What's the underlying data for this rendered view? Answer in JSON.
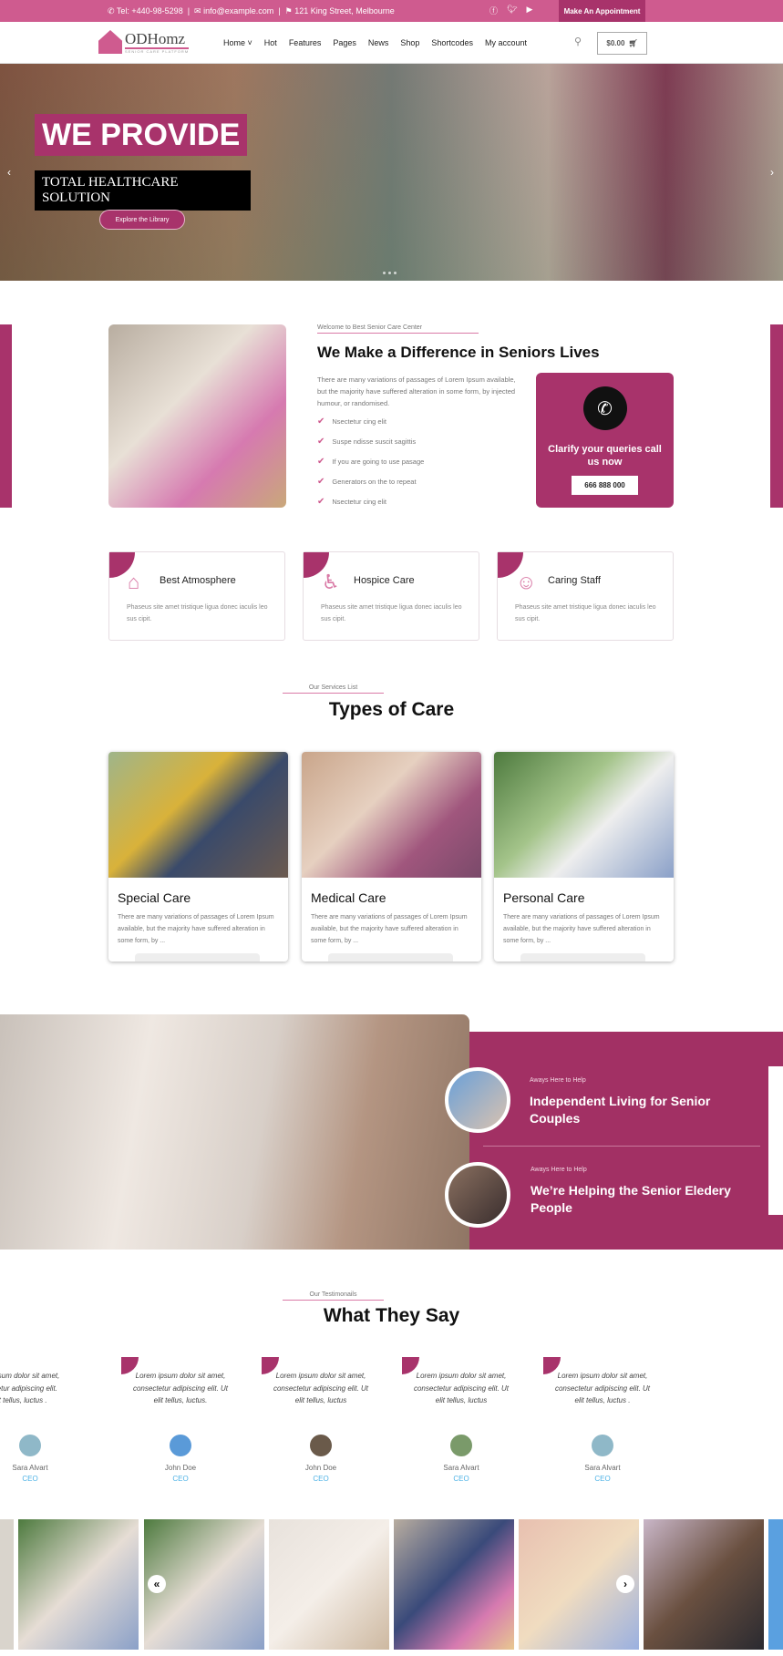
{
  "topbar": {
    "phone": "Tel: +440-98-5298",
    "email": "info@example.com",
    "address": "121 King Street, Melbourne",
    "social": [
      "facebook-icon",
      "twitter-icon",
      "youtube-icon"
    ],
    "appointment": "Make An Appointment"
  },
  "header": {
    "logo": "ODHomz",
    "logo_tagline": "SENIOR CARE PLATFORM",
    "nav": [
      "Home",
      "Hot",
      "Features",
      "Pages",
      "News",
      "Shop",
      "Shortcodes",
      "My account"
    ],
    "cart": "$0.00"
  },
  "hero": {
    "title": "WE PROVIDE",
    "subtitle": "TOTAL HEALTHCARE SOLUTION",
    "button": "Explore the Library"
  },
  "about": {
    "eyebrow": "Welcome to Best Senior Care Center",
    "title": "We Make a Difference in Seniors Lives",
    "text": "There are many variations of passages of Lorem Ipsum available, but the majority have suffered alteration in some form, by injected humour, or randomised.",
    "list": [
      "Nsectetur cing elit",
      "Suspe ndisse suscit sagittis",
      "If you are going to use pasage",
      "Generators on the to repeat",
      "Nsectetur cing elit"
    ],
    "call_text": "Clarify your queries call us now",
    "call_number": "666 888 000"
  },
  "features": [
    {
      "title": "Best Atmosphere",
      "icon": "house-icon",
      "text": "Phaseus site amet tristique ligua donec iaculis leo sus cipit."
    },
    {
      "title": "Hospice Care",
      "icon": "elder-walker-icon",
      "text": "Phaseus site amet tristique ligua donec iaculis leo sus cipit."
    },
    {
      "title": "Caring Staff",
      "icon": "nurse-icon",
      "text": "Phaseus site amet tristique ligua donec iaculis leo sus cipit."
    }
  ],
  "services": {
    "eyebrow": "Our Services List",
    "title": "Types of Care",
    "items": [
      {
        "title": "Special Care",
        "text": "There are many variations of passages of Lorem Ipsum available, but the majority have suffered alteration in some form, by ..."
      },
      {
        "title": "Medical Care",
        "text": "There are many variations of passages of Lorem Ipsum available, but the majority have suffered alteration in some form, by ..."
      },
      {
        "title": "Personal Care",
        "text": "There are many variations of passages of Lorem Ipsum available, but the majority have suffered alteration in some form, by ..."
      }
    ]
  },
  "help": [
    {
      "eyebrow": "Aways Here to Help",
      "title": "Independent Living for Senior Couples"
    },
    {
      "eyebrow": "Aways Here to Help",
      "title": "We’re Helping the Senior Eledery People"
    }
  ],
  "testimonials": {
    "eyebrow": "Our Testimonails",
    "title": "What They Say",
    "items": [
      {
        "text": "Lorem ipsum dolor sit amet, consectetur adipiscing elit. Ut elit tellus, luctus .",
        "name": "Sara Alvart",
        "role": "CEO"
      },
      {
        "text": "Lorem ipsum dolor sit amet, consectetur adipiscing elit. Ut elit tellus, luctus.",
        "name": "John Doe",
        "role": "CEO"
      },
      {
        "text": "Lorem ipsum dolor sit amet, consectetur adipiscing elit. Ut elit tellus, luctus",
        "name": "John Doe",
        "role": "CEO"
      },
      {
        "text": "Lorem ipsum dolor sit amet, consectetur adipiscing elit. Ut elit tellus, luctus",
        "name": "Sara Alvart",
        "role": "CEO"
      },
      {
        "text": "Lorem ipsum dolor sit amet, consectetur adipiscing elit. Ut elit tellus, luctus .",
        "name": "Sara Alvart",
        "role": "CEO"
      }
    ]
  },
  "colors": {
    "primary": "#a8336b",
    "topbar": "#cf5b8f",
    "accent_blue": "#4fb3e6"
  }
}
